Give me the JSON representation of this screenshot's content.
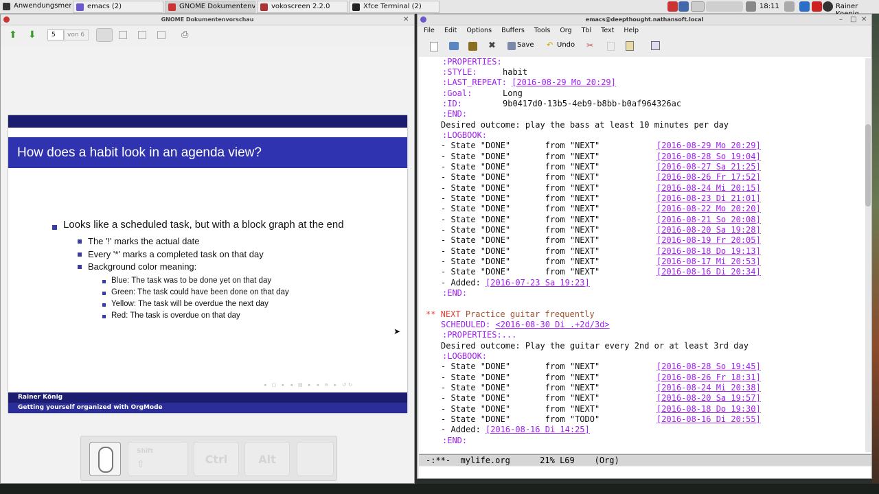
{
  "taskbar": {
    "menu_label": "Anwendungsmenü",
    "tasks": [
      {
        "label": "emacs (2)"
      },
      {
        "label": "GNOME Dokumentenvor..."
      },
      {
        "label": "vokoscreen 2.2.0"
      },
      {
        "label": "Xfce Terminal (2)"
      }
    ],
    "clock": "18:11",
    "user": "Rainer Koenig"
  },
  "doc_viewer": {
    "title": "GNOME Dokumentenvorschau",
    "page_number": "5",
    "page_of": "von 6",
    "slide": {
      "heading": "How does a habit look in an agenda view?",
      "bullet": "Looks like a scheduled task, but with a block graph at the end",
      "sub_bullets": [
        "The '!' marks the actual date",
        "Every '*' marks a completed task on that day",
        "Background color meaning:"
      ],
      "color_meanings": [
        "Blue:  The task was to be done yet on that day",
        "Green:  The task could have been done on that day",
        "Yellow:  The task will be overdue the next day",
        "Red:  The task is overdue on that day"
      ],
      "footer_author": "Rainer König",
      "footer_title": "Getting yourself organized with OrgMode"
    },
    "keys": {
      "shift": "Shift",
      "ctrl": "Ctrl",
      "alt": "Alt"
    }
  },
  "emacs": {
    "title": "emacs@deepthought.nathansoft.local",
    "menu": [
      "File",
      "Edit",
      "Options",
      "Buffers",
      "Tools",
      "Org",
      "Tbl",
      "Text",
      "Help"
    ],
    "toolbar": {
      "save": "Save",
      "undo": "Undo"
    },
    "properties": {
      "open": ":PROPERTIES:",
      "style_key": ":STYLE:",
      "style_val": "habit",
      "last_repeat_key": ":LAST_REPEAT:",
      "last_repeat_val": "[2016-08-29 Mo 20:29]",
      "goal_key": ":Goal:",
      "goal_val": "Long",
      "id_key": ":ID:",
      "id_val": "9b0417d0-13b5-4eb9-b8bb-b0af964326ac",
      "end": ":END:"
    },
    "outcome1": "Desired outcome: play the bass at least 10 minutes per day",
    "logbook_label": ":LOGBOOK:",
    "log1": [
      {
        "state": "- State \"DONE\"       from \"NEXT\"",
        "date": "[2016-08-29 Mo 20:29]"
      },
      {
        "state": "- State \"DONE\"       from \"NEXT\"",
        "date": "[2016-08-28 So 19:04]"
      },
      {
        "state": "- State \"DONE\"       from \"NEXT\"",
        "date": "[2016-08-27 Sa 21:25]"
      },
      {
        "state": "- State \"DONE\"       from \"NEXT\"",
        "date": "[2016-08-26 Fr 17:52]"
      },
      {
        "state": "- State \"DONE\"       from \"NEXT\"",
        "date": "[2016-08-24 Mi 20:15]"
      },
      {
        "state": "- State \"DONE\"       from \"NEXT\"",
        "date": "[2016-08-23 Di 21:01]"
      },
      {
        "state": "- State \"DONE\"       from \"NEXT\"",
        "date": "[2016-08-22 Mo 20:20]"
      },
      {
        "state": "- State \"DONE\"       from \"NEXT\"",
        "date": "[2016-08-21 So 20:08]"
      },
      {
        "state": "- State \"DONE\"       from \"NEXT\"",
        "date": "[2016-08-20 Sa 19:28]"
      },
      {
        "state": "- State \"DONE\"       from \"NEXT\"",
        "date": "[2016-08-19 Fr 20:05]"
      },
      {
        "state": "- State \"DONE\"       from \"NEXT\"",
        "date": "[2016-08-18 Do 19:13]"
      },
      {
        "state": "- State \"DONE\"       from \"NEXT\"",
        "date": "[2016-08-17 Mi 20:53]"
      },
      {
        "state": "- State \"DONE\"       from \"NEXT\"",
        "date": "[2016-08-16 Di 20:34]"
      }
    ],
    "added1_label": "- Added: ",
    "added1_date": "[2016-07-23 Sa 19:23]",
    "end_label": ":END:",
    "heading2_stars": "** ",
    "heading2_kw": "NEXT",
    "heading2_title": " Practice guitar frequently",
    "scheduled_label": "SCHEDULED: ",
    "scheduled_date": "<2016-08-30 Di .+2d/3d>",
    "properties_folded": ":PROPERTIES:...",
    "outcome2": "Desired outcome: Play the guitar every 2nd or at least 3rd day",
    "log2": [
      {
        "state": "- State \"DONE\"       from \"NEXT\"",
        "date": "[2016-08-28 So 19:45]"
      },
      {
        "state": "- State \"DONE\"       from \"NEXT\"",
        "date": "[2016-08-26 Fr 18:31]"
      },
      {
        "state": "- State \"DONE\"       from \"NEXT\"",
        "date": "[2016-08-24 Mi 20:38]"
      },
      {
        "state": "- State \"DONE\"       from \"NEXT\"",
        "date": "[2016-08-20 Sa 19:57]"
      },
      {
        "state": "- State \"DONE\"       from \"NEXT\"",
        "date": "[2016-08-18 Do 19:30]"
      },
      {
        "state": "- State \"DONE\"       from \"TODO\"",
        "date": "[2016-08-16 Di 20:55]"
      }
    ],
    "added2_date": "[2016-08-16 Di 14:25]",
    "modeline": "-:**-  mylife.org      21% L69    (Org)"
  }
}
